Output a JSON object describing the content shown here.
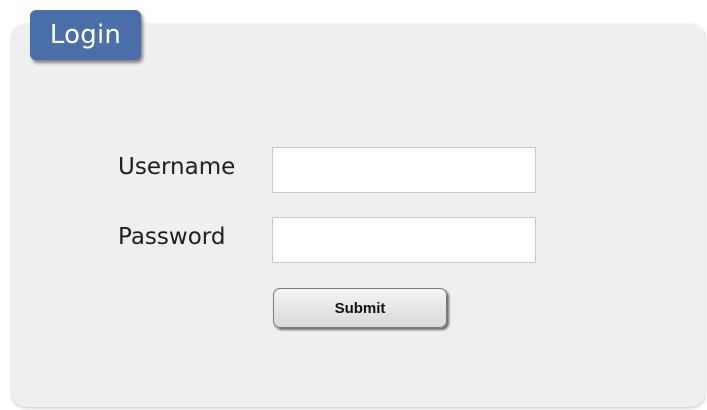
{
  "login": {
    "tab_title": "Login",
    "username_label": "Username",
    "username_value": "",
    "password_label": "Password",
    "password_value": "",
    "submit_label": "Submit"
  },
  "colors": {
    "tab_background": "#4a6fa8",
    "panel_background": "#efefef"
  }
}
